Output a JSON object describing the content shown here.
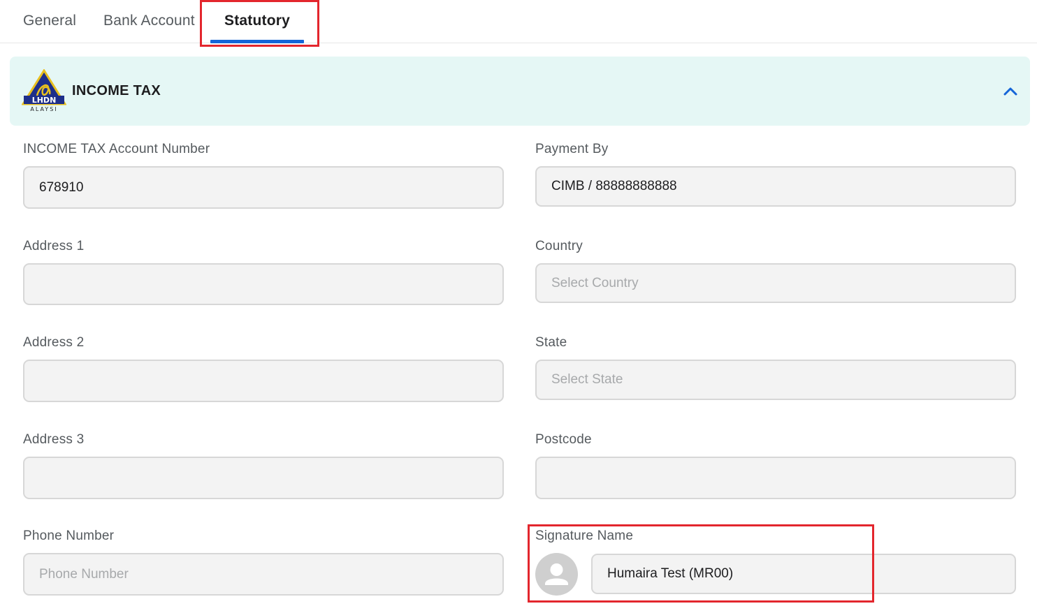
{
  "tabs": [
    {
      "label": "General",
      "active": false
    },
    {
      "label": "Bank Account",
      "active": false
    },
    {
      "label": "Statutory",
      "active": true
    }
  ],
  "section": {
    "title": "INCOME TAX",
    "logo_text": "LHDN",
    "logo_subtext": "ALAYSI",
    "collapse_icon": "chevron-up-icon"
  },
  "form": {
    "account_number": {
      "label": "INCOME TAX Account Number",
      "value": "678910"
    },
    "payment_by": {
      "label": "Payment By",
      "value": "CIMB / 88888888888"
    },
    "address1": {
      "label": "Address 1",
      "value": ""
    },
    "country": {
      "label": "Country",
      "placeholder": "Select Country"
    },
    "address2": {
      "label": "Address 2",
      "value": ""
    },
    "state": {
      "label": "State",
      "placeholder": "Select State"
    },
    "address3": {
      "label": "Address 3",
      "value": ""
    },
    "postcode": {
      "label": "Postcode",
      "value": ""
    },
    "phone": {
      "label": "Phone Number",
      "placeholder": "Phone Number"
    },
    "signature": {
      "label": "Signature Name",
      "value": "Humaira Test (MR00)",
      "avatar_icon": "user-avatar-icon"
    }
  },
  "colors": {
    "accent": "#1565d8",
    "highlight": "#e3262d",
    "section_bg": "#e5f7f5"
  }
}
